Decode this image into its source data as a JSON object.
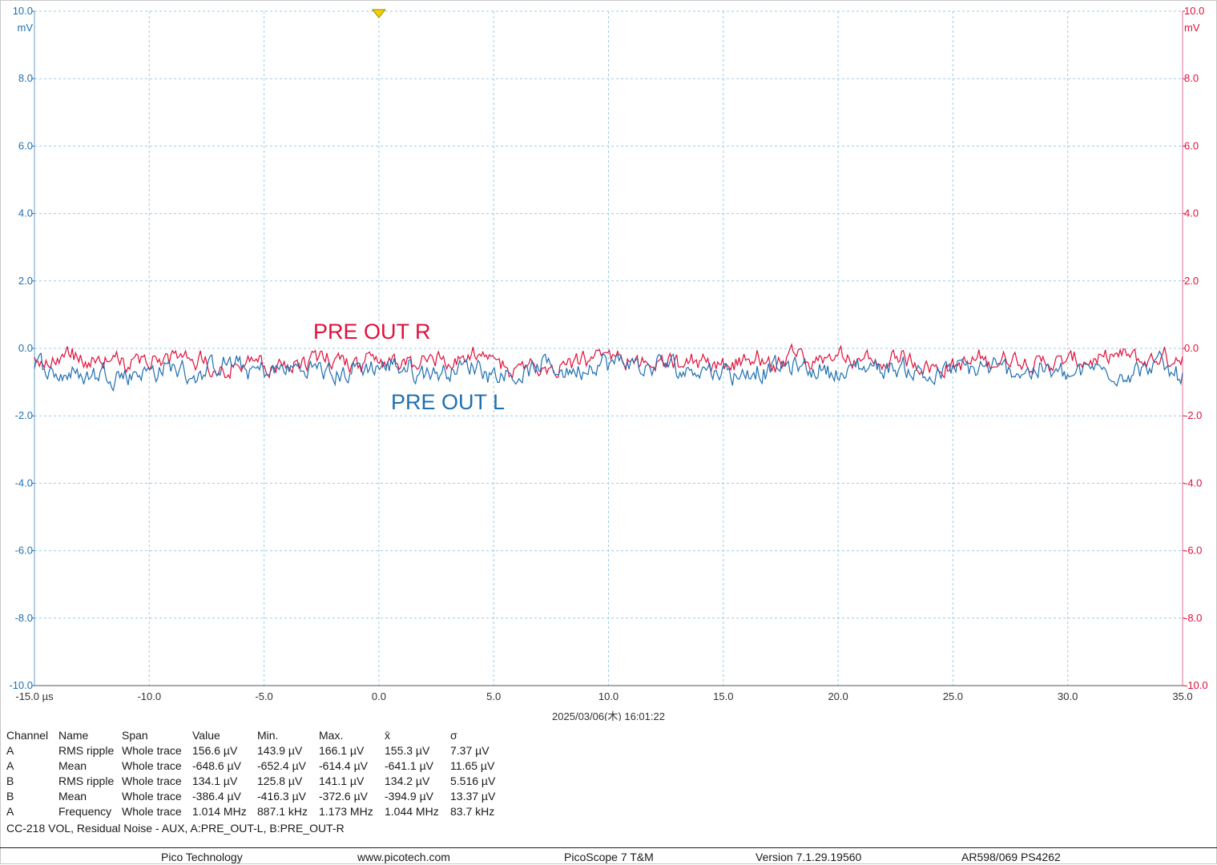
{
  "chart_data": {
    "type": "line",
    "x": {
      "min": -15.0,
      "max": 35.0,
      "unit": "µs",
      "ticks": [
        "-15.0 µs",
        "-10.0",
        "-5.0",
        "0.0",
        "5.0",
        "10.0",
        "15.0",
        "20.0",
        "25.0",
        "30.0",
        "35.0"
      ]
    },
    "y_left": {
      "min": -10.0,
      "max": 10.0,
      "unit": "mV",
      "color": "#1f6fb0",
      "ticks": [
        "10.0",
        "8.0",
        "6.0",
        "4.0",
        "2.0",
        "0.0",
        "-2.0",
        "-4.0",
        "-6.0",
        "-8.0",
        "-10.0"
      ]
    },
    "y_right": {
      "min": -10.0,
      "max": 10.0,
      "unit": "mV",
      "color": "#e0103a",
      "ticks": [
        "10.0",
        "8.0",
        "6.0",
        "4.0",
        "2.0",
        "0.0",
        "-2.0",
        "-4.0",
        "-6.0",
        "-8.0",
        "-10.0"
      ]
    },
    "grid": true,
    "trigger_marker_x": 0.0,
    "timestamp": "2025/03/06(木) 16:01:22",
    "series": [
      {
        "name": "PRE OUT R",
        "channel": "B",
        "color": "#e0103a",
        "mean_mV": -0.386,
        "rms_mV": 0.134,
        "peak_to_peak_mV": 1.0
      },
      {
        "name": "PRE OUT L",
        "channel": "A",
        "color": "#1f6fb0",
        "mean_mV": -0.649,
        "rms_mV": 0.157,
        "peak_to_peak_mV": 1.2
      }
    ]
  },
  "measurements": {
    "headers": [
      "Channel",
      "Name",
      "Span",
      "Value",
      "Min.",
      "Max.",
      "x̄",
      "σ"
    ],
    "rows": [
      [
        "A",
        "RMS ripple",
        "Whole trace",
        "156.6 µV",
        "143.9 µV",
        "166.1 µV",
        "155.3 µV",
        "7.37 µV"
      ],
      [
        "A",
        "Mean",
        "Whole trace",
        "-648.6 µV",
        "-652.4 µV",
        "-614.4 µV",
        "-641.1 µV",
        "11.65 µV"
      ],
      [
        "B",
        "RMS ripple",
        "Whole trace",
        "134.1 µV",
        "125.8 µV",
        "141.1 µV",
        "134.2 µV",
        "5.516 µV"
      ],
      [
        "B",
        "Mean",
        "Whole trace",
        "-386.4 µV",
        "-416.3 µV",
        "-372.6 µV",
        "-394.9 µV",
        "13.37 µV"
      ],
      [
        "A",
        "Frequency",
        "Whole trace",
        "1.014 MHz",
        "887.1 kHz",
        "1.173 MHz",
        "1.044 MHz",
        "83.7 kHz"
      ]
    ]
  },
  "note": "CC-218 VOL, Residual Noise - AUX, A:PRE_OUT-L, B:PRE_OUT-R",
  "footer": {
    "company": "Pico Technology",
    "website": "www.picotech.com",
    "product": "PicoScope 7 T&M",
    "version": "Version 7.1.29.19560",
    "device": "AR598/069 PS4262"
  }
}
